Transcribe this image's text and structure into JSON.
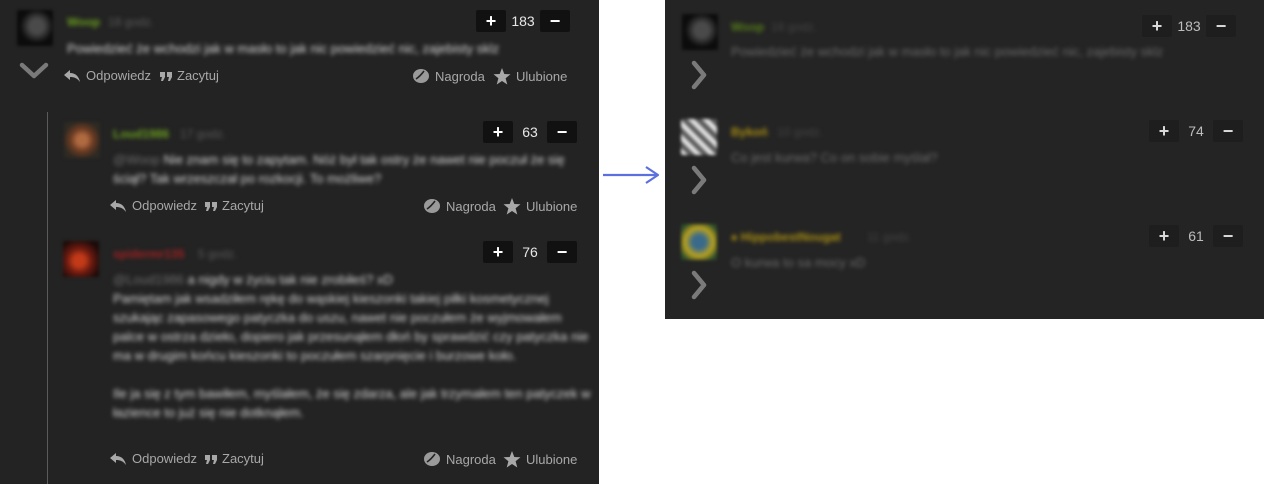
{
  "colors": {
    "panel_bg": "#232323",
    "vote_button_bg": "#111111",
    "action_text": "#a8a8a8",
    "username_green": "#6a9e1f",
    "username_red": "#a02020",
    "username_gold": "#a98e12",
    "arrow": "#5b6fe0"
  },
  "left": {
    "comments": [
      {
        "username": "Woop",
        "ago": "18 godz.",
        "body": "Powiedzieć że wchodzi jak w masło to jak nic powiedzieć nic, zajebisty sklz",
        "score": "183",
        "plus": "+",
        "minus": "−",
        "actions": {
          "reply": "Odpowiedz",
          "quote": "Zacytuj",
          "award": "Nagroda",
          "favorite": "Ulubione"
        }
      },
      {
        "username": "Loud1986",
        "ago": "17 godz.",
        "quote_ref": "@Woop",
        "body": "Nie znam się to zapytam. Nóż był tak ostry że nawet nie poczuł że się ściął? Tak wrzeszczał po rozkocji. To możliwe?",
        "score": "63",
        "plus": "+",
        "minus": "−",
        "actions": {
          "reply": "Odpowiedz",
          "quote": "Zacytuj",
          "award": "Nagroda",
          "favorite": "Ulubione"
        }
      },
      {
        "username": "spidermr135",
        "ago": "5 godz.",
        "quote_ref": "@Loud1986",
        "body_lines": [
          "a nigdy w życiu tak nie zrobiłeś? xD",
          "Pamiętam jak wsadziłem rękę do wąskiej kieszonki takiej piłki kosmetycznej szukając zapasowego patyczka do uszu, nawet nie poczułem że wyjmowałem palce w ostrza dzieło, dopiero jak przesunąłem dłoń by sprawdzić czy patyczka nie ma w drugim końcu kieszonki to poczułem szarpnięcie i burzowe koło.",
          "",
          "Ile ja się z tym bawiłem, myślałem, że się zdarza, ale jak trzymałem ten patyczek w łazience to już się nie dotknąłem."
        ],
        "score": "76",
        "plus": "+",
        "minus": "−",
        "actions": {
          "reply": "Odpowiedz",
          "quote": "Zacytuj",
          "award": "Nagroda",
          "favorite": "Ulubione"
        }
      }
    ]
  },
  "right": {
    "comments": [
      {
        "username": "Woop",
        "ago": "18 godz.",
        "body": "Powiedzieć że wchodzi jak w masło to jak nic powiedzieć nic, zajebisty sklz",
        "score": "183",
        "plus": "+",
        "minus": "−"
      },
      {
        "username": "Bykoń",
        "ago": "10 godz.",
        "body": "Co jest kurwa? Co on sobie myślał?",
        "score": "74",
        "plus": "+",
        "minus": "−"
      },
      {
        "username": "♠ HippobestNougat",
        "ago": "11 godz.",
        "body": "O kurwa to sa mocy xD",
        "score": "61",
        "plus": "+",
        "minus": "−"
      }
    ]
  }
}
